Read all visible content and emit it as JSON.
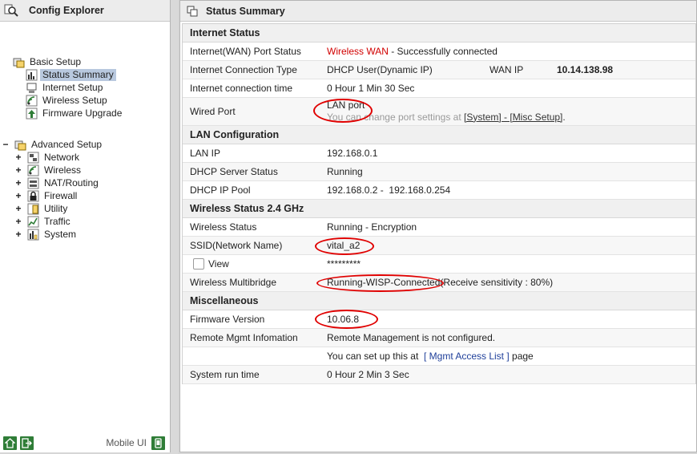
{
  "left": {
    "title": "Config Explorer",
    "basic_setup": {
      "label": "Basic Setup",
      "items": [
        {
          "label": "Status Summary",
          "selected": true
        },
        {
          "label": "Internet Setup"
        },
        {
          "label": "Wireless Setup"
        },
        {
          "label": "Firmware Upgrade"
        }
      ]
    },
    "advanced_setup": {
      "toggle": "−",
      "label": "Advanced Setup",
      "items": [
        {
          "toggle": "+",
          "label": "Network"
        },
        {
          "toggle": "+",
          "label": "Wireless"
        },
        {
          "toggle": "+",
          "label": "NAT/Routing"
        },
        {
          "toggle": "+",
          "label": "Firewall"
        },
        {
          "toggle": "+",
          "label": "Utility"
        },
        {
          "toggle": "+",
          "label": "Traffic"
        },
        {
          "toggle": "+",
          "label": "System"
        }
      ]
    },
    "footer": {
      "mobile_label": "Mobile UI"
    }
  },
  "right": {
    "title": "Status Summary",
    "internet": {
      "title": "Internet Status",
      "wan_port_label": "Internet(WAN) Port Status",
      "wan_port_value_red": "Wireless WAN",
      "wan_port_value_rest": " - Successfully connected",
      "conn_type_label": "Internet Connection Type",
      "conn_type_value": "DHCP User(Dynamic IP)",
      "wan_ip_label": "WAN IP",
      "wan_ip_value": "10.14.138.98",
      "conn_time_label": "Internet connection time",
      "conn_time_value": "0 Hour 1 Min 30 Sec",
      "wired_port_label": "Wired Port",
      "wired_port_value": "LAN port",
      "wired_port_note_pre": "You can change port settings at ",
      "wired_port_link1": "[System] - [Misc Setup]",
      "wired_port_note_post": "."
    },
    "lan": {
      "title": "LAN Configuration",
      "lan_ip_label": "LAN IP",
      "lan_ip_value": "192.168.0.1",
      "dhcp_status_label": "DHCP Server Status",
      "dhcp_status_value": "Running",
      "dhcp_pool_label": "DHCP IP Pool",
      "dhcp_pool_value": "192.168.0.2 -  192.168.0.254"
    },
    "wireless": {
      "title": "Wireless Status 2.4 GHz",
      "status_label": "Wireless Status",
      "status_value": "Running - Encryption",
      "ssid_label": "SSID(Network Name)",
      "ssid_value": "vital_a2",
      "view_label": "View",
      "password_value": "*********",
      "multibridge_label": "Wireless Multibridge",
      "multibridge_value": "Running-WISP-Connected",
      "multibridge_extra": "(Receive sensitivity : 80%)"
    },
    "misc": {
      "title": "Miscellaneous",
      "firmware_label": "Firmware Version",
      "firmware_value": "10.06.8",
      "remote_label": "Remote Mgmt Infomation",
      "remote_value": "Remote Management is not configured.",
      "remote_setup_pre": "You can set up this at  ",
      "remote_setup_link": "[ Mgmt Access List ]",
      "remote_setup_post": " page",
      "runtime_label": "System run time",
      "runtime_value": "0 Hour 2 Min 3 Sec"
    }
  },
  "colors": {
    "accent_red": "#d10000",
    "link_blue": "#1f3f9a",
    "selection": "#b8c8de",
    "icon_green": "#2f7d37"
  }
}
